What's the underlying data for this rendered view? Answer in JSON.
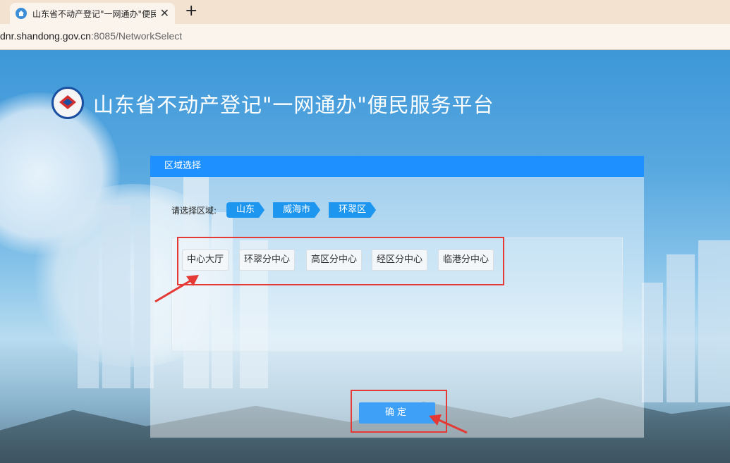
{
  "browser": {
    "tab_title": "山东省不动产登记\"一网通办\"便民",
    "tab_close": "✕",
    "new_tab": "+",
    "url_host": "dnr.shandong.gov.cn",
    "url_path": ":8085/NetworkSelect"
  },
  "header": {
    "site_title": "山东省不动产登记\"一网通办\"便民服务平台"
  },
  "panel": {
    "title": "区域选择",
    "region_label": "请选择区域:",
    "breadcrumbs": [
      "山东",
      "威海市",
      "环翠区"
    ],
    "options": [
      "中心大厅",
      "环翠分中心",
      "高区分中心",
      "经区分中心",
      "临港分中心"
    ],
    "confirm_label": "确定"
  },
  "colors": {
    "accent": "#1e90ff",
    "annotation": "#e53935"
  }
}
